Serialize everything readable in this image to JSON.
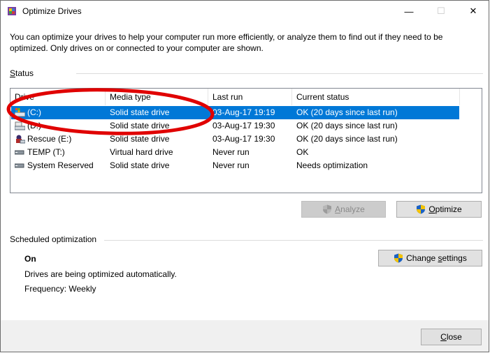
{
  "window": {
    "title": "Optimize Drives",
    "minimize_glyph": "—",
    "maximize_glyph": "☐",
    "close_glyph": "✕"
  },
  "intro": "You can optimize your drives to help your computer run more efficiently, or analyze them to find out if they need to be optimized. Only drives on or connected to your computer are shown.",
  "status": {
    "label_prefix": "S",
    "label_rest": "tatus",
    "columns": [
      "Drive",
      "Media type",
      "Last run",
      "Current status"
    ],
    "rows": [
      {
        "drive": "(C:)",
        "media": "Solid state drive",
        "last_run": "03-Aug-17 19:19",
        "status": "OK (20 days since last run)",
        "icon": "system-drive-icon",
        "selected": true
      },
      {
        "drive": "(D:)",
        "media": "Solid state drive",
        "last_run": "03-Aug-17 19:30",
        "status": "OK (20 days since last run)",
        "icon": "drive-icon",
        "selected": false
      },
      {
        "drive": "Rescue (E:)",
        "media": "Solid state drive",
        "last_run": "03-Aug-17 19:30",
        "status": "OK (20 days since last run)",
        "icon": "rescue-drive-icon",
        "selected": false
      },
      {
        "drive": "TEMP (T:)",
        "media": "Virtual hard drive",
        "last_run": "Never run",
        "status": "OK",
        "icon": "virtual-drive-icon",
        "selected": false
      },
      {
        "drive": "System Reserved",
        "media": "Solid state drive",
        "last_run": "Never run",
        "status": "Needs optimization",
        "icon": "drive-icon",
        "selected": false
      }
    ]
  },
  "buttons": {
    "analyze_prefix": "A",
    "analyze_rest": "nalyze",
    "optimize_prefix": "O",
    "optimize_rest": "ptimize",
    "change_prefix": "Change ",
    "change_ul": "s",
    "change_rest": "ettings",
    "close_prefix": "C",
    "close_rest": "lose"
  },
  "scheduled": {
    "label": "Scheduled optimization",
    "state": "On",
    "description": "Drives are being optimized automatically.",
    "frequency": "Frequency: Weekly"
  },
  "colors": {
    "selection": "#0078d7",
    "annotation": "#e00000"
  }
}
